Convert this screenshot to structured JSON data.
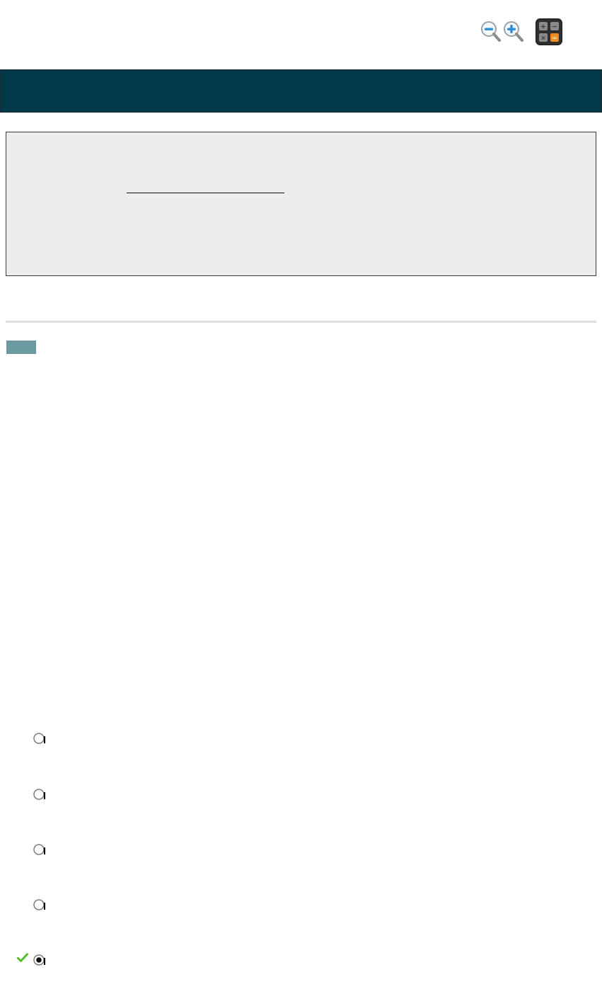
{
  "toolbar": {
    "zoom_out_icon": "zoom-out-icon",
    "zoom_in_icon": "zoom-in-icon",
    "calculator_icon": "calculator-icon"
  },
  "header": {
    "title": ""
  },
  "question": {
    "badge": "",
    "choices": [
      {
        "label": "",
        "selected": false
      },
      {
        "label": "",
        "selected": false
      },
      {
        "label": "",
        "selected": false
      },
      {
        "label": "",
        "selected": false
      },
      {
        "label": "",
        "selected": true
      }
    ],
    "correct_marker_icon": "checkmark-icon"
  },
  "colors": {
    "header_bg": "#023a4a",
    "panel_bg": "#ededed",
    "badge_bg": "#6b9aa0",
    "check_green": "#4fbf2a"
  }
}
